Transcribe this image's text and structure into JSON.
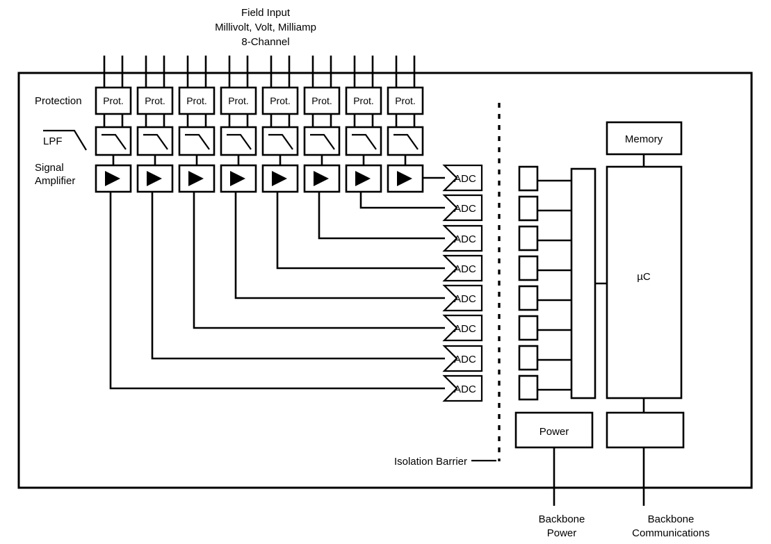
{
  "diagram": {
    "title_lines": [
      "Field Input",
      "Millivolt, Volt, Milliamp",
      "8-Channel"
    ],
    "row_labels": {
      "protection": "Protection",
      "lpf": "LPF",
      "amplifier_line1": "Signal",
      "amplifier_line2": "Amplifier"
    },
    "channel_count": 8,
    "protection_label": "Prot.",
    "adc_label": "ADC",
    "adc_count": 8,
    "isolator_count": 8,
    "blocks": {
      "memory": "Memory",
      "microcontroller": "µC",
      "power": "Power",
      "comms": ""
    },
    "annotations": {
      "isolation_barrier": "Isolation Barrier"
    },
    "bottom_labels": [
      {
        "line1": "Backbone",
        "line2": "Power"
      },
      {
        "line1": "Backbone",
        "line2": "Communications"
      }
    ],
    "colors": {
      "stroke": "#000000",
      "fill": "#ffffff",
      "background": "#ffffff"
    }
  }
}
